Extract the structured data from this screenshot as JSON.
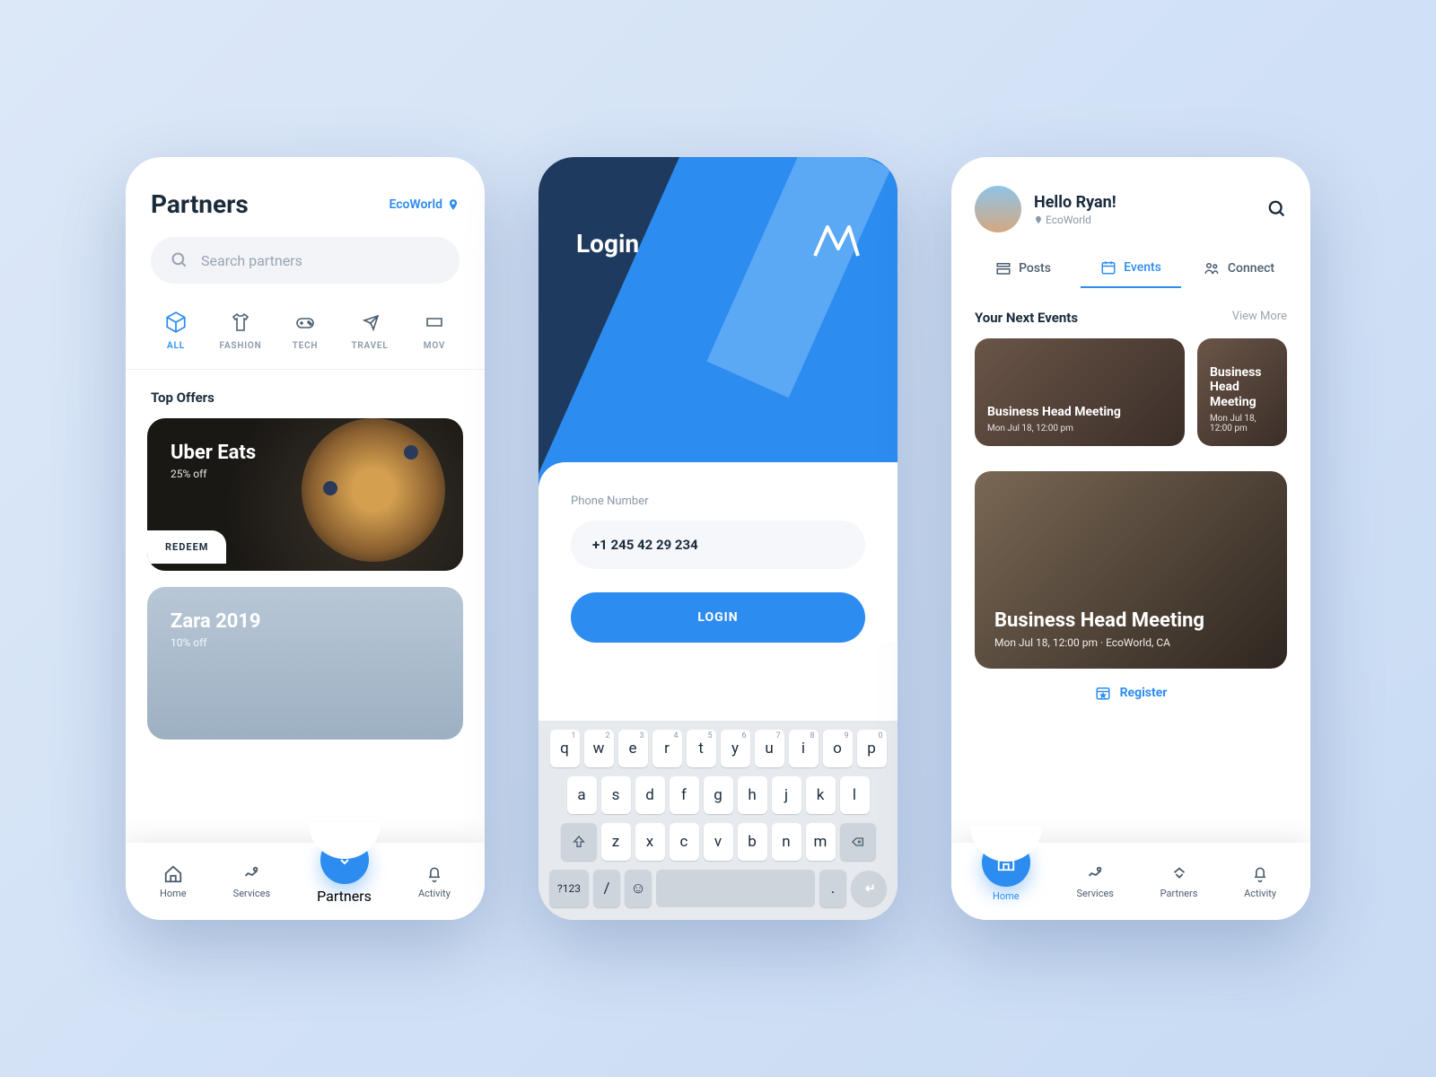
{
  "colors": {
    "accent": "#2d8cf0",
    "navy": "#1e3a5f"
  },
  "partners": {
    "title": "Partners",
    "location": "EcoWorld",
    "search_placeholder": "Search partners",
    "categories": [
      {
        "id": "all",
        "label": "ALL"
      },
      {
        "id": "fashion",
        "label": "FASHION"
      },
      {
        "id": "tech",
        "label": "TECH"
      },
      {
        "id": "travel",
        "label": "TRAVEL"
      },
      {
        "id": "movies",
        "label": "MOV"
      }
    ],
    "section": "Top Offers",
    "offers": [
      {
        "title": "Uber Eats",
        "sub": "25% off",
        "cta": "REDEEM"
      },
      {
        "title": "Zara 2019",
        "sub": "10% off"
      }
    ]
  },
  "login": {
    "title": "Login",
    "field_label": "Phone Number",
    "field_value": "+1 245 42 29 234",
    "button": "LOGIN",
    "keyboard": {
      "row1": [
        {
          "k": "q",
          "n": "1"
        },
        {
          "k": "w",
          "n": "2"
        },
        {
          "k": "e",
          "n": "3"
        },
        {
          "k": "r",
          "n": "4"
        },
        {
          "k": "t",
          "n": "5"
        },
        {
          "k": "y",
          "n": "6"
        },
        {
          "k": "u",
          "n": "7"
        },
        {
          "k": "i",
          "n": "8"
        },
        {
          "k": "o",
          "n": "9"
        },
        {
          "k": "p",
          "n": "0"
        }
      ],
      "row2": [
        "a",
        "s",
        "d",
        "f",
        "g",
        "h",
        "j",
        "k",
        "l"
      ],
      "row3": [
        "z",
        "x",
        "c",
        "v",
        "b",
        "n",
        "m"
      ],
      "row4": {
        "sym": "?123",
        "slash": "/",
        "dot": "."
      }
    }
  },
  "home": {
    "greeting": "Hello Ryan!",
    "location": "EcoWorld",
    "tabs": [
      {
        "id": "posts",
        "label": "Posts"
      },
      {
        "id": "events",
        "label": "Events"
      },
      {
        "id": "connect",
        "label": "Connect"
      }
    ],
    "events_header": "Your Next Events",
    "view_more": "View More",
    "small_events": [
      {
        "title": "Business Head Meeting",
        "date": "Mon Jul 18, 12:00 pm"
      },
      {
        "title": "Business Head Meeting",
        "date": "Mon Jul 18, 12:00 pm"
      }
    ],
    "featured": {
      "title": "Business Head Meeting",
      "date": "Mon Jul 18, 12:00 pm · EcoWorld, CA"
    },
    "register": "Register"
  },
  "nav": [
    {
      "id": "home",
      "label": "Home"
    },
    {
      "id": "services",
      "label": "Services"
    },
    {
      "id": "partners",
      "label": "Partners"
    },
    {
      "id": "activity",
      "label": "Activity"
    }
  ]
}
